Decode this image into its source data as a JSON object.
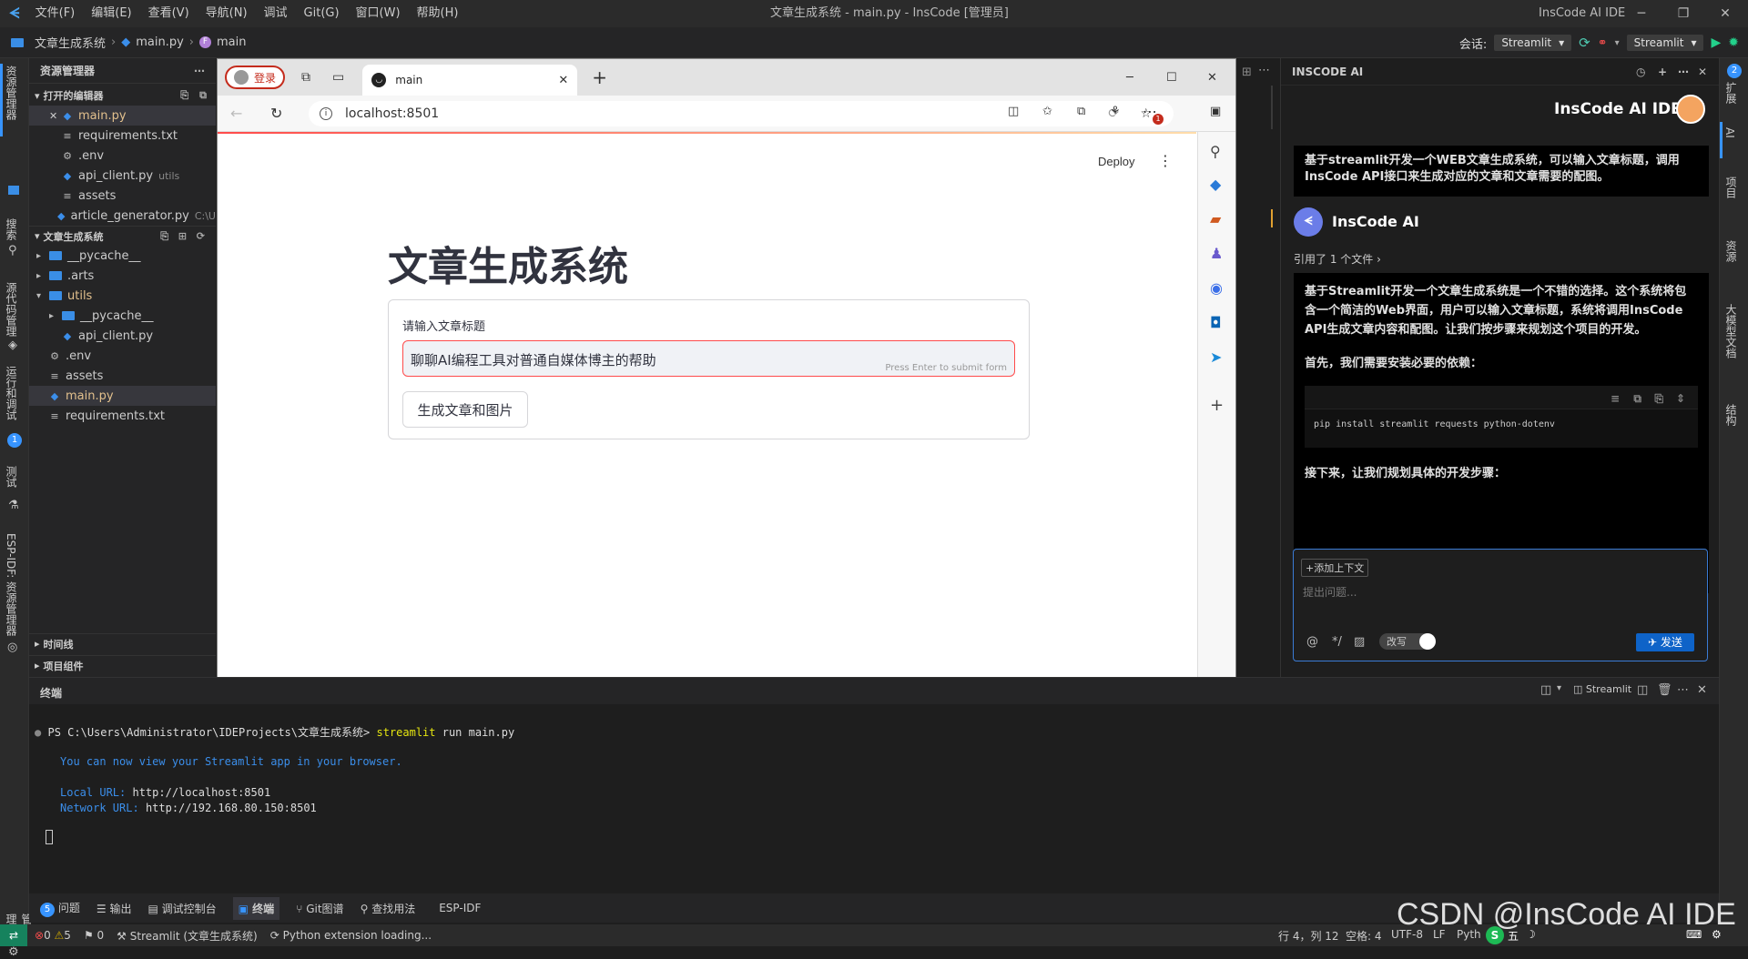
{
  "titlebar": {
    "menus": [
      "文件(F)",
      "编辑(E)",
      "查看(V)",
      "导航(N)",
      "调试",
      "Git(G)",
      "窗口(W)",
      "帮助(H)"
    ],
    "window_title": "文章生成系统 - main.py - InsCode [管理员]",
    "app_name": "InsCode AI IDE"
  },
  "crumbs": {
    "project": "文章生成系统",
    "file": "main.py",
    "symbol": "main"
  },
  "runbar": {
    "session_label": "会话:",
    "session_value": "Streamlit",
    "run_config": "Streamlit"
  },
  "left_activity": [
    "资源管理器",
    "搜索",
    "源代码管理",
    "运行和调试",
    "测试",
    "ESP-IDF: 资源管理器",
    "管理"
  ],
  "left_activity_badge": "1",
  "right_activity": [
    "扩展",
    "AI",
    "项目",
    "资源",
    "大模型文档",
    "结构"
  ],
  "right_activity_badge": "2",
  "explorer": {
    "title": "资源管理器",
    "open_editors_title": "打开的编辑器",
    "open_editors": [
      {
        "name": "main.py",
        "note": "",
        "type": "py",
        "active": true,
        "close": true
      },
      {
        "name": "requirements.txt",
        "note": "",
        "type": "txt"
      },
      {
        "name": ".env",
        "note": "",
        "type": "gear"
      },
      {
        "name": "api_client.py",
        "note": "utils",
        "type": "py"
      },
      {
        "name": "assets",
        "note": "",
        "type": "txt"
      },
      {
        "name": "article_generator.py",
        "note": "C:\\U",
        "type": "py"
      }
    ],
    "project_title": "文章生成系统",
    "project_tree": [
      {
        "name": "__pycache__",
        "depth": 0,
        "kind": "folder",
        "arrow": "▸"
      },
      {
        "name": ".arts",
        "depth": 0,
        "kind": "folder",
        "arrow": "▸"
      },
      {
        "name": "utils",
        "depth": 0,
        "kind": "folder",
        "arrow": "▾",
        "hl": true
      },
      {
        "name": "__pycache__",
        "depth": 1,
        "kind": "folder",
        "arrow": "▸"
      },
      {
        "name": "api_client.py",
        "depth": 1,
        "kind": "py",
        "arrow": ""
      },
      {
        "name": ".env",
        "depth": 0,
        "kind": "gear",
        "arrow": ""
      },
      {
        "name": "assets",
        "depth": 0,
        "kind": "txt",
        "arrow": ""
      },
      {
        "name": "main.py",
        "depth": 0,
        "kind": "py",
        "arrow": "",
        "active": true
      },
      {
        "name": "requirements.txt",
        "depth": 0,
        "kind": "txt",
        "arrow": ""
      }
    ],
    "timeline": "时间线",
    "components": "项目组件"
  },
  "browser": {
    "login": "登录",
    "tab_title": "main",
    "url": "localhost:8501",
    "notif_badge": "1",
    "deploy": "Deploy",
    "page_title": "文章生成系统",
    "input_label": "请输入文章标题",
    "input_value": "聊聊AI编程工具对普通自媒体博主的帮助",
    "input_hint": "Press Enter to submit form",
    "submit": "生成文章和图片"
  },
  "panel": {
    "title": "终端",
    "right_label": "Streamlit"
  },
  "terminal": {
    "prompt": "PS C:\\Users\\Administrator\\IDEProjects\\文章生成系统>",
    "cmd": "streamlit",
    "args": " run main.py",
    "line1": "You can now view your Streamlit app in your browser.",
    "local_label": "Local URL:",
    "local_url": "http://localhost:8501",
    "net_label": "Network URL:",
    "net_url": "http://192.168.80.150:8501"
  },
  "panel_tabs": {
    "problems_count": "5",
    "items": [
      "问题",
      "输出",
      "调试控制台",
      "终端",
      "Git图谱",
      "查找用法",
      "ESP-IDF"
    ]
  },
  "status": {
    "errors": "0",
    "warnings": "5",
    "ports": "0",
    "run_config": "Streamlit (文章生成系统)",
    "loading": "Python extension loading...",
    "position": "行 4，列 12",
    "spaces": "空格: 4",
    "encoding": "UTF-8",
    "eol": "LF",
    "lang": "Pyth",
    "ime": "五",
    "watermark": "CSDN @InsCode AI IDE"
  },
  "ai": {
    "header": "INSCODE AI",
    "brand": "InsCode AI IDE",
    "user_msg": "基于streamlit开发一个WEB文章生成系统，可以输入文章标题，调用InsCode API接口来生成对应的文章和文章需要的配图。",
    "bot_name": "InsCode AI",
    "ref": "引用了 1 个文件 ›",
    "reply_p1": "基于Streamlit开发一个文章生成系统是一个不错的选择。这个系统将包含一个简洁的Web界面，用户可以输入文章标题，系统将调用InsCode API生成文章内容和配图。让我们按步骤来规划这个项目的开发。",
    "reply_p2": "首先，我们需要安装必要的依赖：",
    "code": "pip install streamlit requests python-dotenv",
    "reply_p3": "接下来，让我们规划具体的开发步骤：",
    "add_context": "+添加上下文",
    "input_placeholder": "提出问题...",
    "rewrite": "改写",
    "send": "发送"
  },
  "colors": {
    "accent": "#007acc",
    "active_file": "#e2c08d",
    "streamlit_red": "#ff4b4b",
    "send_button": "#0e63c8"
  }
}
